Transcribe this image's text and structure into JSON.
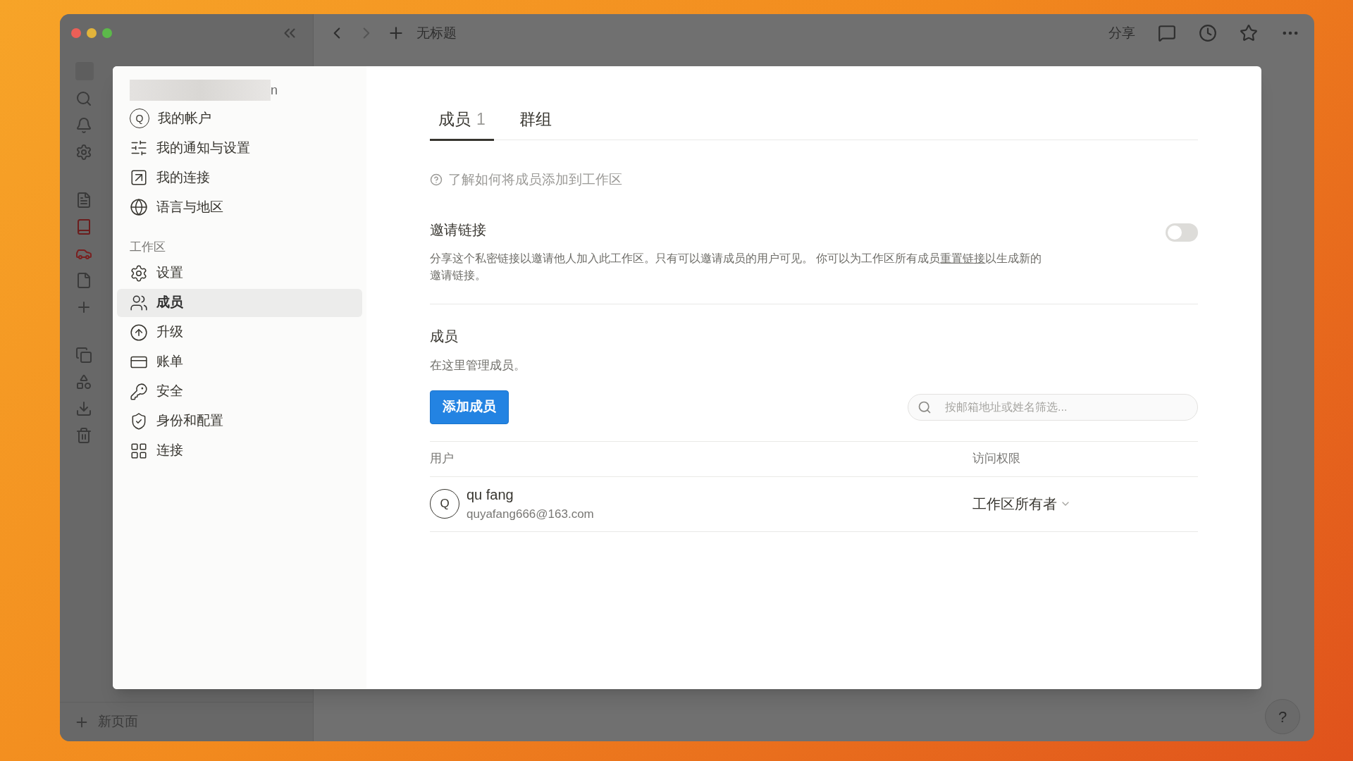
{
  "window": {
    "title": "无标题",
    "actions": [
      "分享"
    ]
  },
  "background_sidebar": {
    "new_page": "新页面"
  },
  "settings_sidebar": {
    "account_tail": "n",
    "account_items": [
      {
        "label": "我的帐户",
        "avatar_letter": "Q",
        "selected": false
      },
      {
        "label": "我的通知与设置",
        "selected": false
      },
      {
        "label": "我的连接",
        "selected": false
      },
      {
        "label": "语言与地区",
        "selected": false
      }
    ],
    "section": "工作区",
    "workspace_items": [
      {
        "label": "设置",
        "selected": false
      },
      {
        "label": "成员",
        "selected": true
      },
      {
        "label": "升级",
        "selected": false
      },
      {
        "label": "账单",
        "selected": false
      },
      {
        "label": "安全",
        "selected": false
      },
      {
        "label": "身份和配置",
        "selected": false
      },
      {
        "label": "连接",
        "selected": false
      }
    ]
  },
  "tabs": [
    {
      "label": "成员",
      "count": "1",
      "selected": true
    },
    {
      "label": "群组",
      "selected": false
    }
  ],
  "help_link": "了解如何将成员添加到工作区",
  "invite_link": {
    "title": "邀请链接",
    "on": false,
    "description": "分享这个私密链接以邀请他人加入此工作区。只有可以邀请成员的用户可见。 你可以为工作区所有成员",
    "reset_link": "重置链接",
    "description_end": "以生成新的邀请链接。"
  },
  "members": {
    "title": "成员",
    "subtitle": "在这里管理成员。",
    "add_button": "添加成员",
    "search": {
      "placeholder": "按邮箱地址或姓名筛选..."
    },
    "table": {
      "columns": [
        "用户",
        "访问权限"
      ],
      "rows": [
        {
          "avatar_letter": "Q",
          "name": "qu fang",
          "email": "quyafang666@163.com",
          "access": "工作区所有者"
        }
      ]
    }
  },
  "help_button": "?"
}
